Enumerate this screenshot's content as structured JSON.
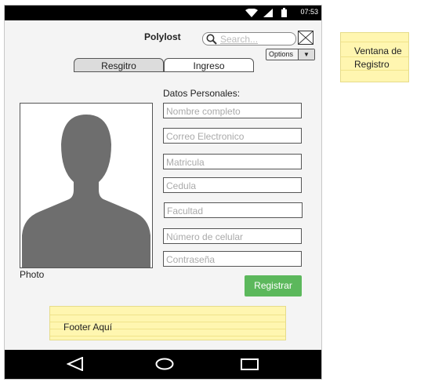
{
  "status": {
    "time": "07:53"
  },
  "header": {
    "title": "Polylost",
    "search_placeholder": "Search...",
    "options_label": "Options"
  },
  "tabs": [
    {
      "label": "Resgitro"
    },
    {
      "label": "Ingreso"
    }
  ],
  "form": {
    "section_title": "Datos Personales:",
    "fields": [
      "Nombre completo",
      "Correo Electronico",
      "Matricula",
      "Cedula",
      "Facultad",
      "Número de celular",
      "Contraseña"
    ],
    "submit_label": "Registrar"
  },
  "photo": {
    "caption": "Photo"
  },
  "footer": {
    "note": "Footer Aquí"
  },
  "annotation": {
    "line1": "Ventana de",
    "line2": "Registro"
  },
  "colors": {
    "accent": "#5cb85c",
    "note": "#fff6b0"
  },
  "icons": [
    "wifi-icon",
    "signal-icon",
    "battery-icon",
    "search-icon",
    "close-icon",
    "chevron-down-icon",
    "back-icon",
    "home-icon",
    "recents-icon"
  ]
}
